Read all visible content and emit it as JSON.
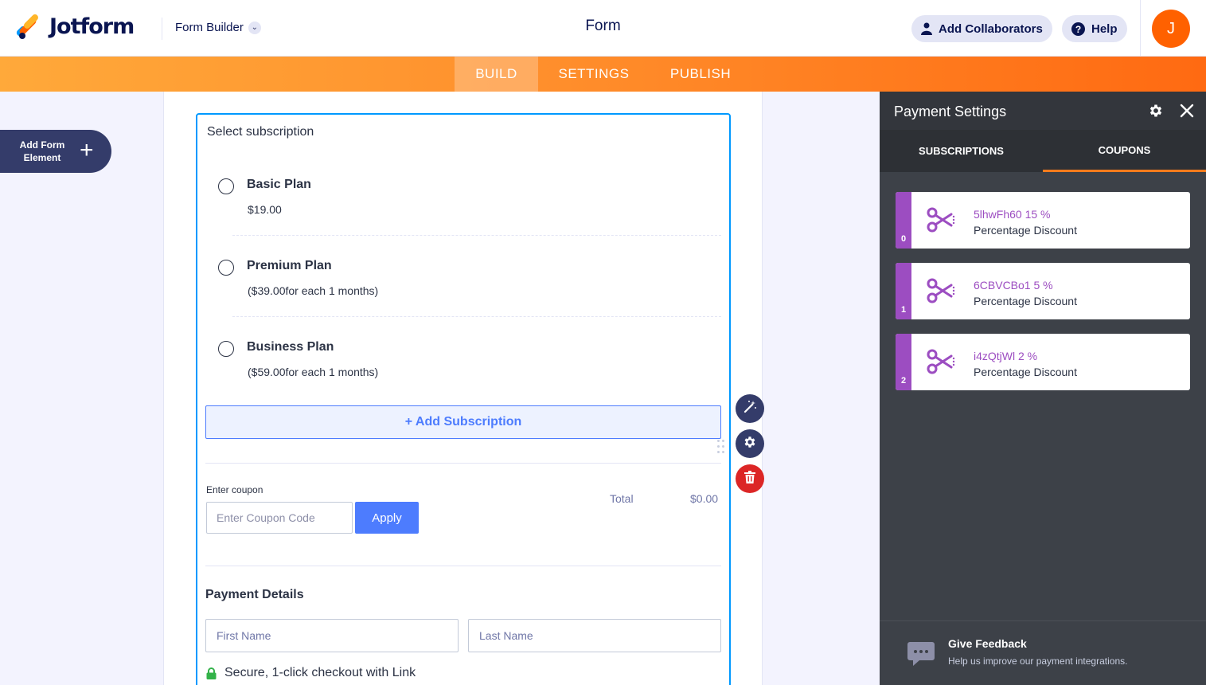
{
  "header": {
    "logo_text": "Jotform",
    "builder_label": "Form Builder",
    "form_title": "Form",
    "collaborators_label": "Add Collaborators",
    "help_label": "Help",
    "avatar_initial": "J"
  },
  "nav": {
    "tabs": [
      {
        "label": "BUILD",
        "active": true
      },
      {
        "label": "SETTINGS",
        "active": false
      },
      {
        "label": "PUBLISH",
        "active": false
      }
    ]
  },
  "left": {
    "add_element_label": "Add Form Element"
  },
  "form": {
    "question_label": "Select subscription",
    "plans": [
      {
        "name": "Basic Plan",
        "price": "$19.00"
      },
      {
        "name": "Premium Plan",
        "price": "($39.00for each 1 months)"
      },
      {
        "name": "Business Plan",
        "price": "($59.00for each 1 months)"
      }
    ],
    "add_subscription_label": "+ Add Subscription",
    "coupon_label": "Enter coupon",
    "coupon_placeholder": "Enter Coupon Code",
    "apply_label": "Apply",
    "total_label": "Total",
    "total_value": "$0.00",
    "payment_details_title": "Payment Details",
    "first_name_placeholder": "First Name",
    "last_name_placeholder": "Last Name",
    "secure_text": "Secure, 1-click checkout with Link"
  },
  "panel": {
    "title": "Payment Settings",
    "tabs": [
      {
        "label": "SUBSCRIPTIONS",
        "active": false
      },
      {
        "label": "COUPONS",
        "active": true
      }
    ],
    "coupons": [
      {
        "index": "0",
        "code": "5lhwFh60 15 %",
        "type": "Percentage Discount"
      },
      {
        "index": "1",
        "code": "6CBVCBo1 5 %",
        "type": "Percentage Discount"
      },
      {
        "index": "2",
        "code": "i4zQtjWl 2 %",
        "type": "Percentage Discount"
      }
    ],
    "feedback_title": "Give Feedback",
    "feedback_sub": "Help us improve our payment integrations."
  },
  "colors": {
    "accent_orange": "#ff6100",
    "coupon_purple": "#9c4dc1",
    "primary_blue": "#4d7cfe",
    "delete_red": "#dc2626",
    "navy": "#0a1551"
  },
  "icons": [
    "jotform-logo-icon",
    "chevron-down-icon",
    "user-icon",
    "help-icon",
    "plus-icon",
    "magic-wand-icon",
    "gear-icon",
    "trash-icon",
    "lock-icon",
    "close-icon",
    "scissors-icon",
    "chat-bubble-icon",
    "drag-handle-icon"
  ]
}
